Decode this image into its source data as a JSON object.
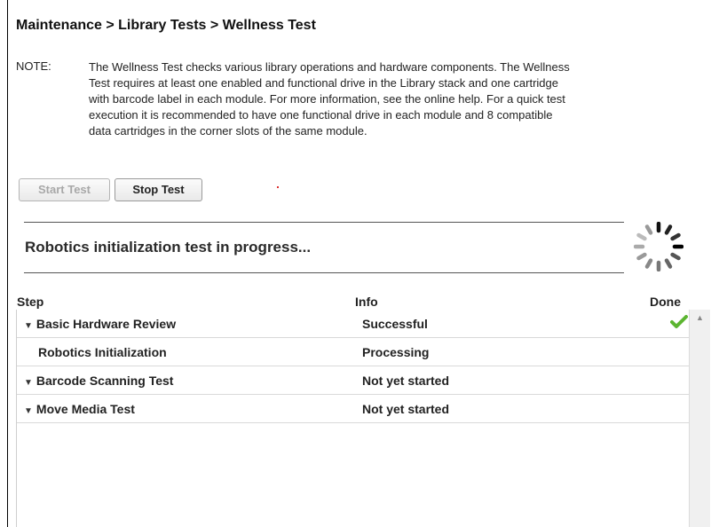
{
  "header": {
    "breadcrumb": "Maintenance > Library Tests > Wellness Test"
  },
  "note": {
    "label": "NOTE:",
    "lines": [
      "The Wellness Test checks various library operations and hardware components. The Wellness",
      "Test requires at least one enabled and functional drive in the Library stack and one cartridge",
      "with barcode label in each module. For more information, see the online help. For a quick test",
      "execution it is recommended to have one functional drive in each module and 8 compatible",
      "data cartridges in the corner slots of the same module."
    ]
  },
  "toolbar": {
    "start_label": "Start Test",
    "start_enabled": false,
    "stop_label": "Stop Test",
    "stop_enabled": true
  },
  "status": {
    "text": "Robotics initialization test in progress...",
    "spinner_icon": "loading-spinner-icon"
  },
  "grid": {
    "columns": {
      "step": "Step",
      "info": "Info",
      "done": "Done"
    },
    "rows": [
      {
        "step": "Basic Hardware Review",
        "info": "Successful",
        "expandable": true,
        "done": true
      },
      {
        "step": "Robotics Initialization",
        "info": "Processing",
        "expandable": false,
        "done": false
      },
      {
        "step": "Barcode Scanning Test",
        "info": "Not yet started",
        "expandable": true,
        "done": false
      },
      {
        "step": "Move Media Test",
        "info": "Not yet started",
        "expandable": true,
        "done": false
      }
    ]
  },
  "colors": {
    "check": "#5cb531",
    "rule": "#555555",
    "disabled_text": "#a8a8a8"
  }
}
